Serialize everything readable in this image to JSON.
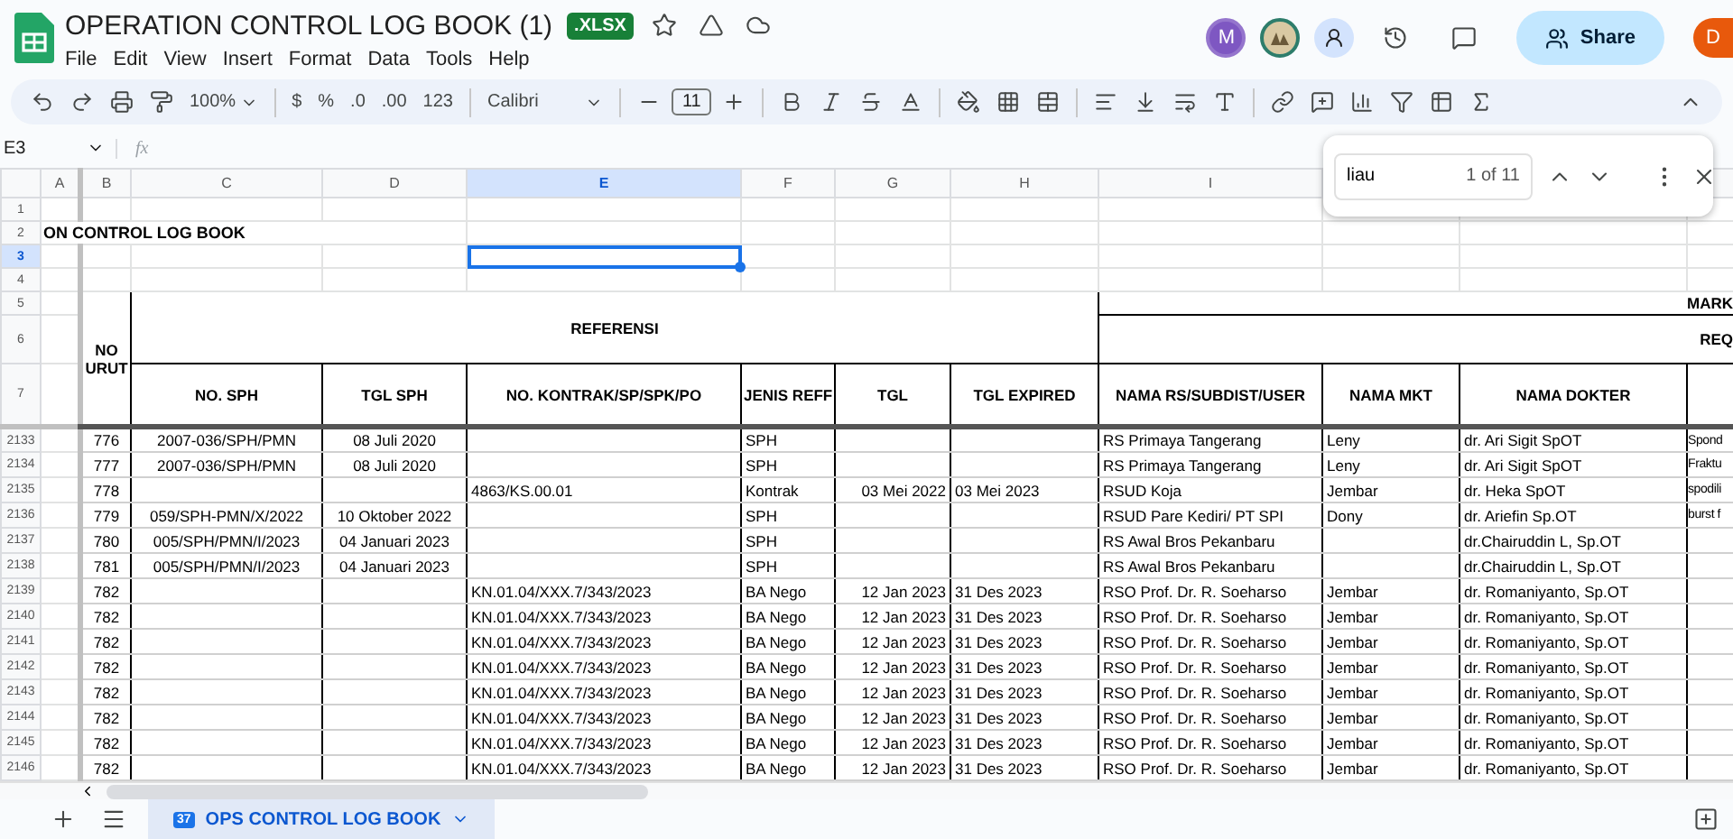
{
  "file": {
    "title": "OPERATION CONTROL LOG BOOK (1)",
    "badge": ".XLSX"
  },
  "menu": [
    "File",
    "Edit",
    "View",
    "Insert",
    "Format",
    "Data",
    "Tools",
    "Help"
  ],
  "account": {
    "collaborator_initial": "M",
    "user_initial": "D",
    "share_label": "Share"
  },
  "toolbar": {
    "zoom": "100%",
    "currency": "$",
    "percent": "%",
    "decrease_decimal": ".0",
    "increase_decimal": ".00",
    "number_format": "123",
    "font": "Calibri",
    "font_size": "11"
  },
  "formula_bar": {
    "cell_ref": "E3",
    "fx": "fx"
  },
  "find": {
    "query": "liau",
    "count": "1 of 11"
  },
  "columns": [
    {
      "label": "A",
      "selected": false
    },
    {
      "label": "B",
      "selected": false
    },
    {
      "label": "C",
      "selected": false
    },
    {
      "label": "D",
      "selected": false
    },
    {
      "label": "E",
      "selected": true
    },
    {
      "label": "F",
      "selected": false
    },
    {
      "label": "G",
      "selected": false
    },
    {
      "label": "H",
      "selected": false
    },
    {
      "label": "I",
      "selected": false
    }
  ],
  "top_rows": [
    {
      "number": "1",
      "selected": false
    },
    {
      "number": "2",
      "selected": false
    },
    {
      "number": "3",
      "selected": true
    },
    {
      "number": "4",
      "selected": false
    }
  ],
  "title_cell": "ON CONTROL LOG BOOK",
  "header": {
    "row_numbers": [
      "5",
      "6",
      "7"
    ],
    "no_urut": "NO URUT",
    "group": "REFERENSI",
    "group_2": "MARK",
    "group_3": "REQ",
    "columns": [
      "NO. SPH",
      "TGL SPH",
      "NO. KONTRAK/SP/SPK/PO",
      "JENIS REFF",
      "TGL",
      "TGL EXPIRED",
      "NAMA RS/SUBDIST/USER",
      "NAMA MKT",
      "NAMA DOKTER"
    ]
  },
  "rows": [
    {
      "number": "2133",
      "cells": {
        "B": "776",
        "C": "2007-036/SPH/PMN",
        "D": "08 Juli 2020",
        "F": "SPH",
        "I": "RS Primaya Tangerang",
        "J": "Leny",
        "K": "dr. Ari Sigit SpOT",
        "L": "Spond"
      }
    },
    {
      "number": "2134",
      "cells": {
        "B": "777",
        "C": "2007-036/SPH/PMN",
        "D": "08 Juli 2020",
        "F": "SPH",
        "I": "RS Primaya Tangerang",
        "J": "Leny",
        "K": "dr. Ari Sigit SpOT",
        "L": "Fraktu"
      }
    },
    {
      "number": "2135",
      "cells": {
        "B": "778",
        "E": "4863/KS.00.01",
        "F": "Kontrak",
        "G": "03 Mei 2022",
        "H": "03 Mei 2023",
        "I": "RSUD Koja",
        "J": "Jembar",
        "K": "dr. Heka SpOT",
        "L": "spodili"
      }
    },
    {
      "number": "2136",
      "cells": {
        "B": "779",
        "C": "059/SPH-PMN/X/2022",
        "D": "10 Oktober 2022",
        "F": "SPH",
        "I": "RSUD Pare Kediri/ PT SPI",
        "J": "Dony",
        "K": "dr. Ariefin Sp.OT",
        "L": "burst f"
      }
    },
    {
      "number": "2137",
      "cells": {
        "B": "780",
        "C": "005/SPH/PMN/I/2023",
        "D": "04 Januari 2023",
        "F": "SPH",
        "I": "RS Awal Bros Pekanbaru",
        "K": "dr.Chairuddin L, Sp.OT"
      }
    },
    {
      "number": "2138",
      "cells": {
        "B": "781",
        "C": "005/SPH/PMN/I/2023",
        "D": "04 Januari 2023",
        "F": "SPH",
        "I": "RS Awal Bros Pekanbaru",
        "K": "dr.Chairuddin L, Sp.OT"
      }
    },
    {
      "number": "2139",
      "cells": {
        "B": "782",
        "E": "KN.01.04/XXX.7/343/2023",
        "F": "BA Nego",
        "G": "12 Jan 2023",
        "H": "31 Des 2023",
        "I": "RSO Prof. Dr. R. Soeharso",
        "J": "Jembar",
        "K": "dr. Romaniyanto, Sp.OT"
      }
    },
    {
      "number": "2140",
      "cells": {
        "B": "782",
        "E": "KN.01.04/XXX.7/343/2023",
        "F": "BA Nego",
        "G": "12 Jan 2023",
        "H": "31 Des 2023",
        "I": "RSO Prof. Dr. R. Soeharso",
        "J": "Jembar",
        "K": "dr. Romaniyanto, Sp.OT"
      }
    },
    {
      "number": "2141",
      "cells": {
        "B": "782",
        "E": "KN.01.04/XXX.7/343/2023",
        "F": "BA Nego",
        "G": "12 Jan 2023",
        "H": "31 Des 2023",
        "I": "RSO Prof. Dr. R. Soeharso",
        "J": "Jembar",
        "K": "dr. Romaniyanto, Sp.OT"
      }
    },
    {
      "number": "2142",
      "cells": {
        "B": "782",
        "E": "KN.01.04/XXX.7/343/2023",
        "F": "BA Nego",
        "G": "12 Jan 2023",
        "H": "31 Des 2023",
        "I": "RSO Prof. Dr. R. Soeharso",
        "J": "Jembar",
        "K": "dr. Romaniyanto, Sp.OT"
      }
    },
    {
      "number": "2143",
      "cells": {
        "B": "782",
        "E": "KN.01.04/XXX.7/343/2023",
        "F": "BA Nego",
        "G": "12 Jan 2023",
        "H": "31 Des 2023",
        "I": "RSO Prof. Dr. R. Soeharso",
        "J": "Jembar",
        "K": "dr. Romaniyanto, Sp.OT"
      }
    },
    {
      "number": "2144",
      "cells": {
        "B": "782",
        "E": "KN.01.04/XXX.7/343/2023",
        "F": "BA Nego",
        "G": "12 Jan 2023",
        "H": "31 Des 2023",
        "I": "RSO Prof. Dr. R. Soeharso",
        "J": "Jembar",
        "K": "dr. Romaniyanto, Sp.OT"
      }
    },
    {
      "number": "2145",
      "cells": {
        "B": "782",
        "E": "KN.01.04/XXX.7/343/2023",
        "F": "BA Nego",
        "G": "12 Jan 2023",
        "H": "31 Des 2023",
        "I": "RSO Prof. Dr. R. Soeharso",
        "J": "Jembar",
        "K": "dr. Romaniyanto, Sp.OT"
      }
    },
    {
      "number": "2146",
      "cells": {
        "B": "782",
        "E": "KN.01.04/XXX.7/343/2023",
        "F": "BA Nego",
        "G": "12 Jan 2023",
        "H": "31 Des 2023",
        "I": "RSO Prof. Dr. R. Soeharso",
        "J": "Jembar",
        "K": "dr. Romaniyanto, Sp.OT"
      }
    }
  ],
  "sheet_tabs": [
    {
      "label": "OPS CONTROL LOG BOOK",
      "badge": "37",
      "selected": true
    }
  ]
}
